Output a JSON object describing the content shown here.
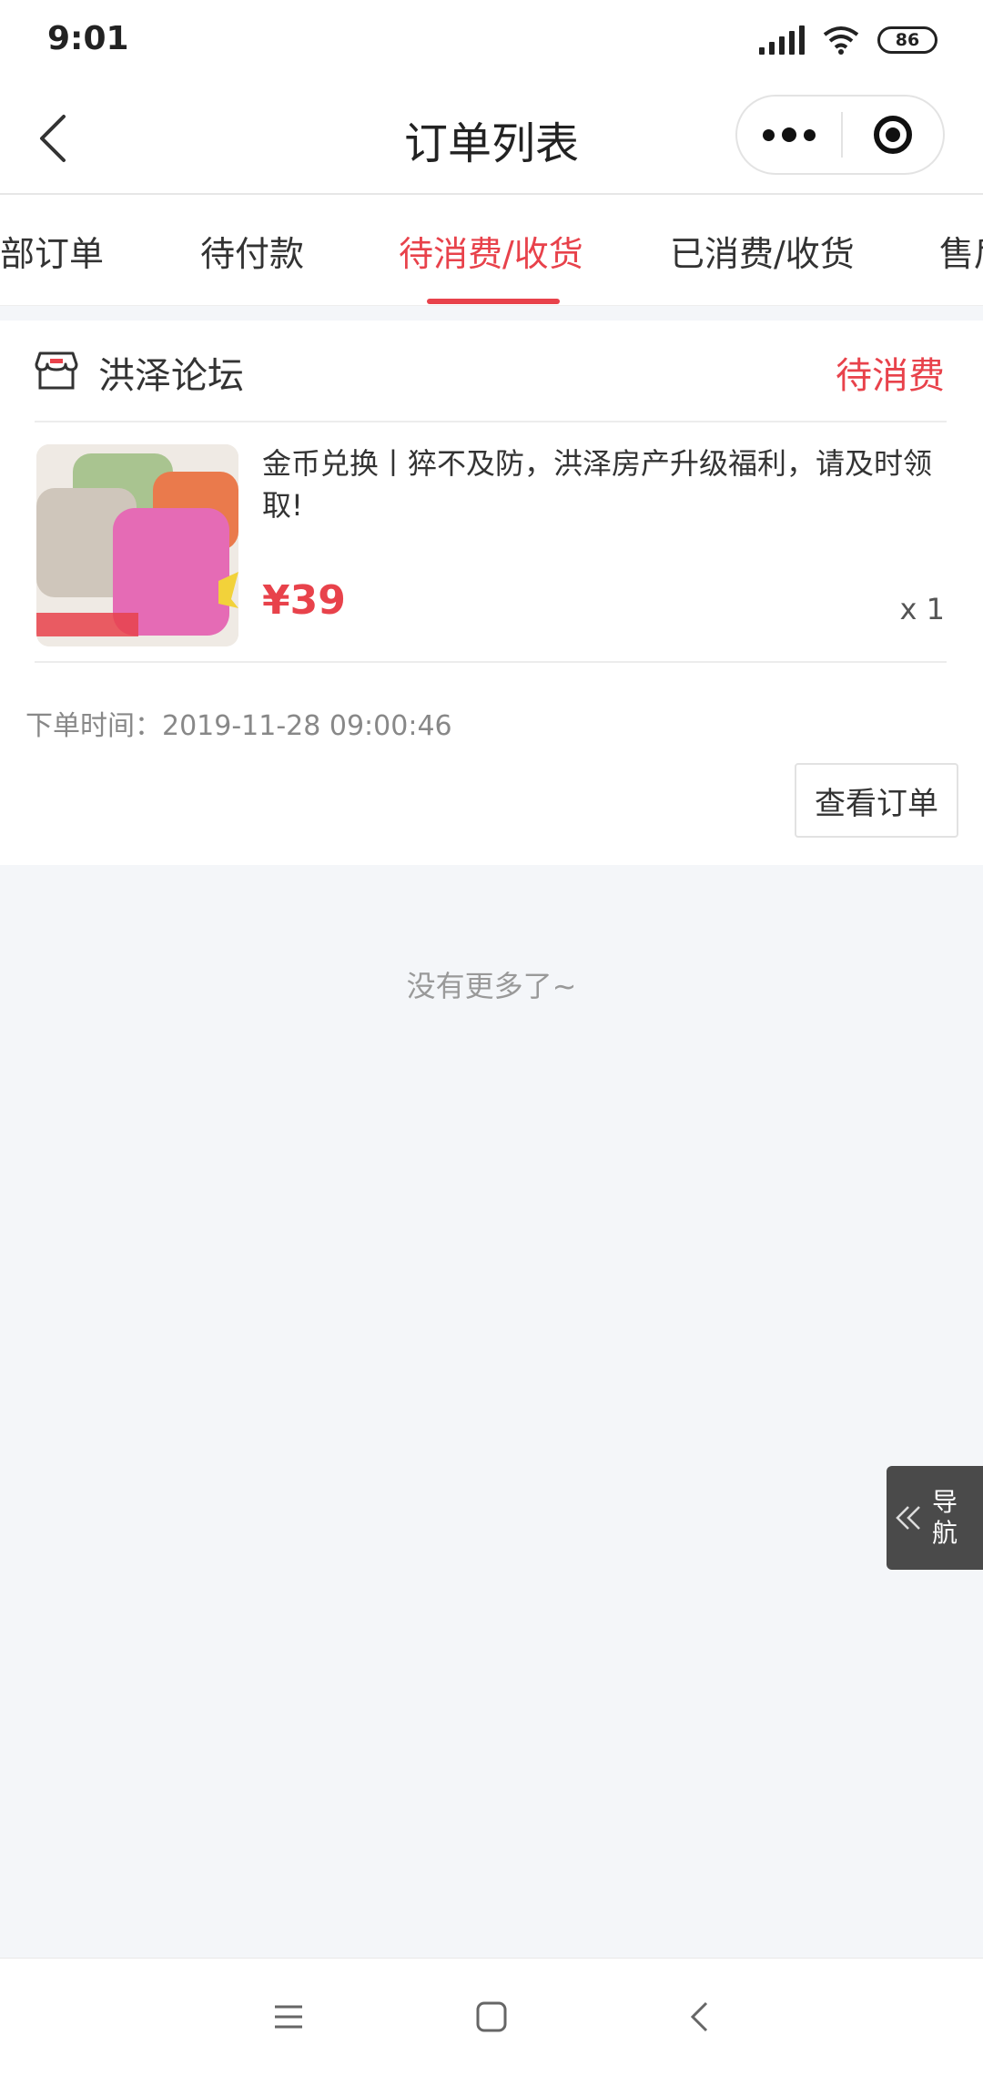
{
  "status_bar": {
    "time": "9:01",
    "battery": "86",
    "icons": [
      "signal-icon",
      "wifi-icon",
      "battery-icon"
    ]
  },
  "nav": {
    "title": "订单列表",
    "back_icon": "chevron-left-icon",
    "more_icon": "more-dots-icon",
    "close_icon": "target-circle-icon"
  },
  "tabs": [
    {
      "label": "部订单",
      "active": false
    },
    {
      "label": "待付款",
      "active": false
    },
    {
      "label": "待消费/收货",
      "active": true
    },
    {
      "label": "已消费/收货",
      "active": false
    },
    {
      "label": "售后",
      "active": false
    }
  ],
  "order": {
    "shop_name": "洪泽论坛",
    "shop_icon": "store-icon",
    "status": "待消费",
    "goods_title": "金币兑换丨猝不及防，洪泽房产升级福利，请及时领取!",
    "price": "¥39",
    "quantity": "x 1",
    "order_time": "下单时间：2019-11-28 09:00:46",
    "view_button": "查看订单"
  },
  "footer_text": "没有更多了~",
  "float_nav": {
    "label": "导航",
    "icon": "double-chevron-left-icon"
  },
  "system_nav": [
    "menu-icon",
    "home-square-icon",
    "back-chevron-icon"
  ],
  "colors": {
    "accent": "#e8424b",
    "background": "#f4f6f9",
    "float_nav_bg": "#4a4a4a"
  }
}
